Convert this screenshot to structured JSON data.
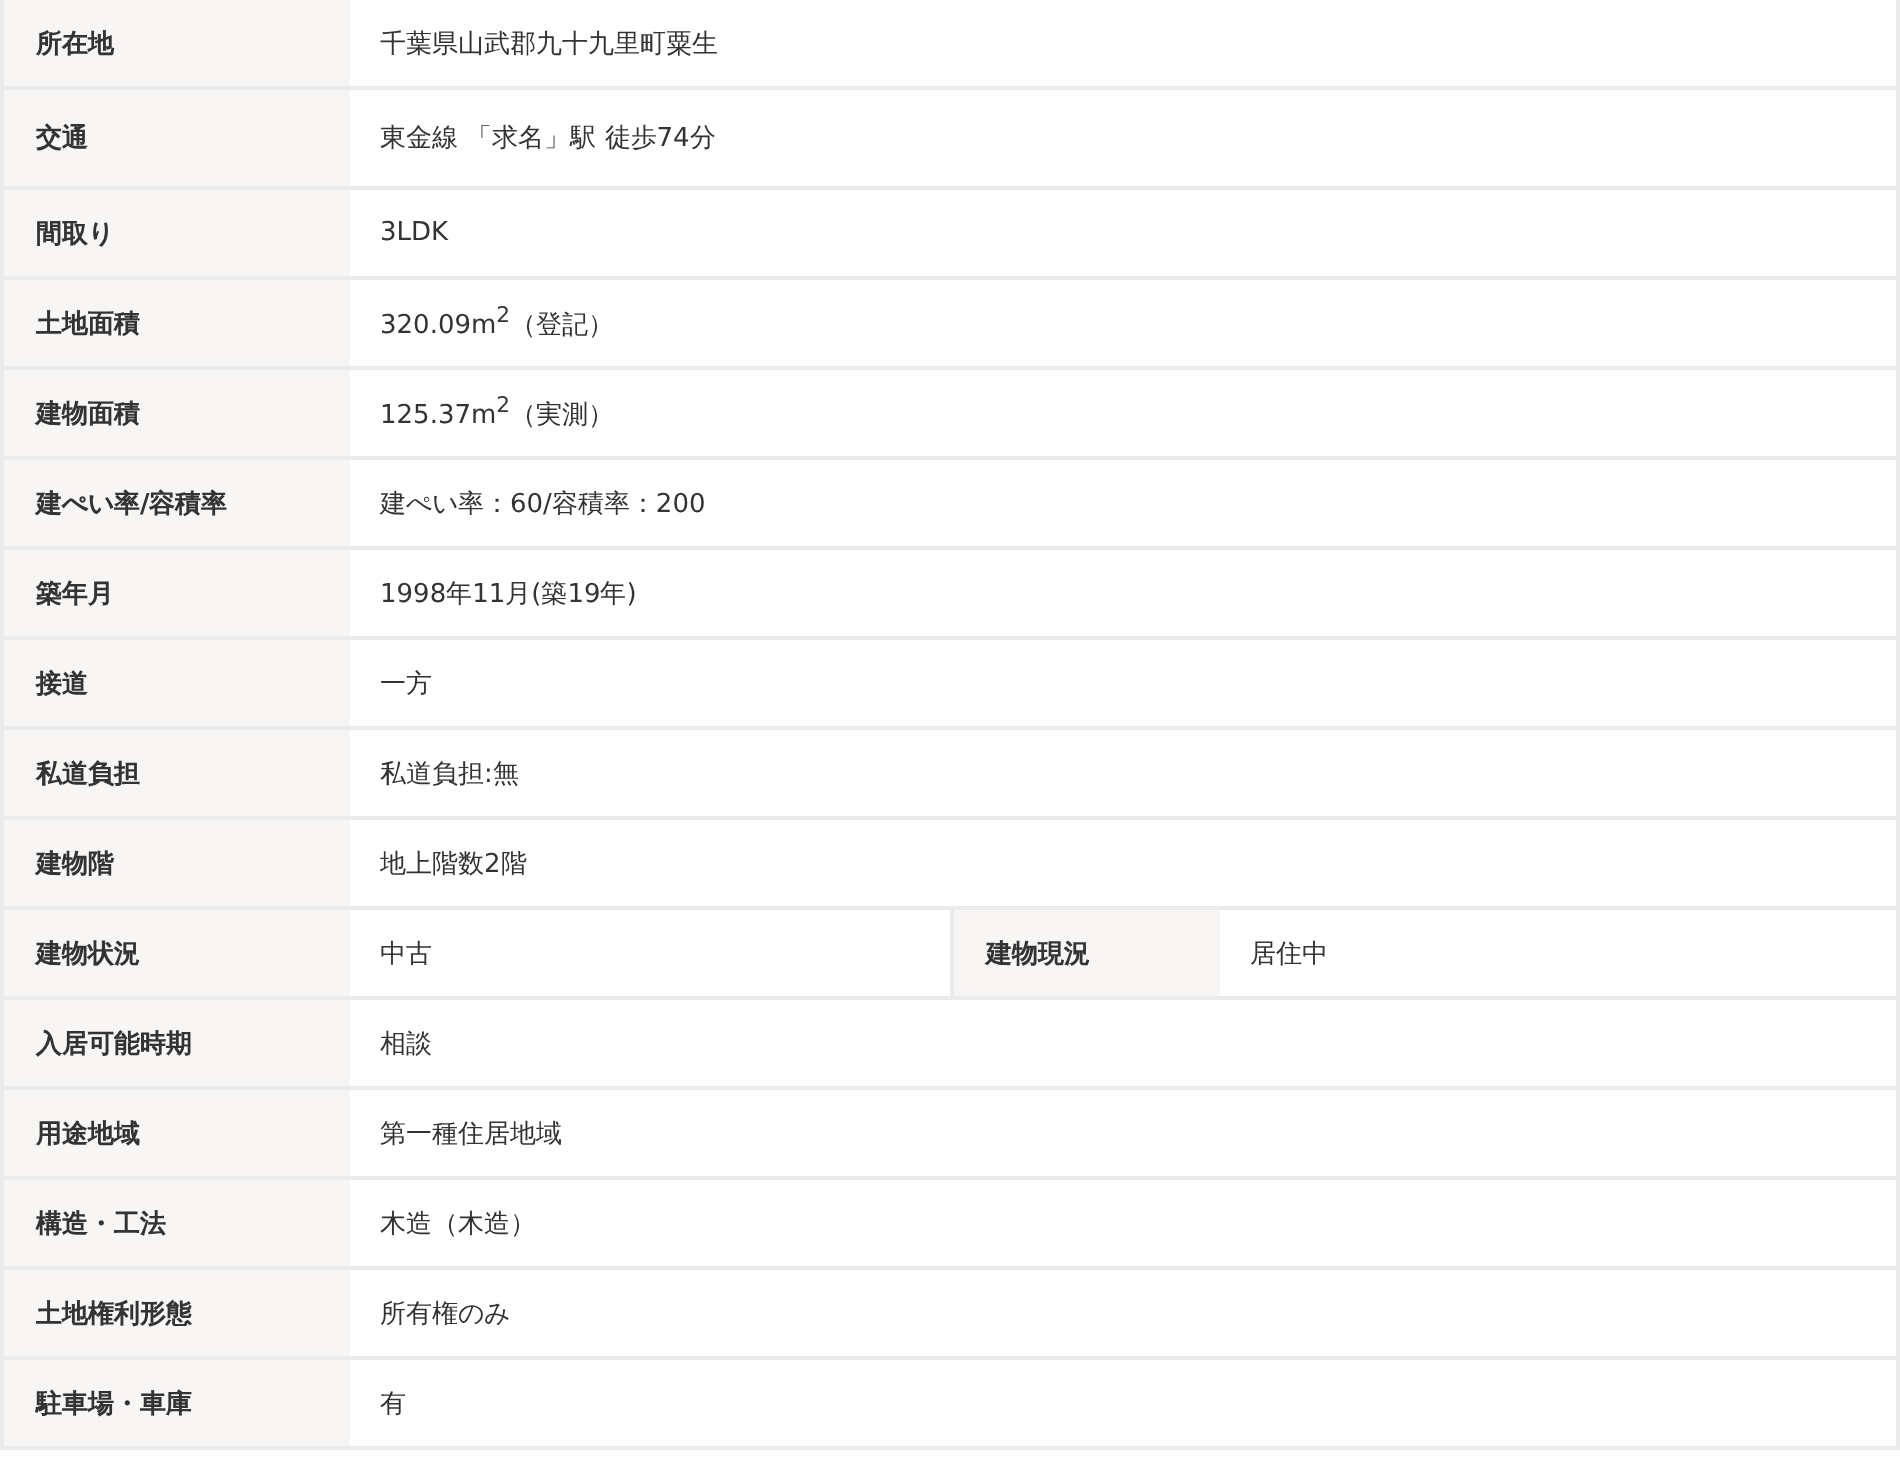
{
  "rows": [
    {
      "cells": [
        {
          "label": "所在地",
          "value": "千葉県山武郡九十九里町粟生"
        }
      ]
    },
    {
      "cells": [
        {
          "label": "交通",
          "value": "東金線 「求名」駅 徒歩74分"
        }
      ]
    },
    {
      "cells": [
        {
          "label": "間取り",
          "value": "3LDK"
        }
      ]
    },
    {
      "cells": [
        {
          "label": "土地面積",
          "value": "320.09m$^{2}$（登記）"
        }
      ]
    },
    {
      "cells": [
        {
          "label": "建物面積",
          "value": "125.37m$^{2}$（実測）"
        }
      ]
    },
    {
      "cells": [
        {
          "label": "建ぺい率/容積率",
          "value": "建ぺい率：60/容積率：200"
        }
      ]
    },
    {
      "cells": [
        {
          "label": "築年月",
          "value": "1998年11月(築19年)"
        }
      ]
    },
    {
      "cells": [
        {
          "label": "接道",
          "value": "一方"
        }
      ]
    },
    {
      "cells": [
        {
          "label": "私道負担",
          "value": "私道負担:無"
        }
      ]
    },
    {
      "cells": [
        {
          "label": "建物階",
          "value": "地上階数2階"
        }
      ]
    },
    {
      "cells": [
        {
          "label": "建物状況",
          "value": "中古"
        },
        {
          "label": "建物現況",
          "value": "居住中"
        }
      ]
    },
    {
      "cells": [
        {
          "label": "入居可能時期",
          "value": "相談"
        }
      ]
    },
    {
      "cells": [
        {
          "label": "用途地域",
          "value": "第一種住居地域"
        }
      ]
    },
    {
      "cells": [
        {
          "label": "構造・工法",
          "value": "木造（木造）"
        }
      ]
    },
    {
      "cells": [
        {
          "label": "土地権利形態",
          "value": "所有権のみ"
        }
      ]
    },
    {
      "cells": [
        {
          "label": "駐車場・車庫",
          "value": "有"
        }
      ]
    }
  ]
}
